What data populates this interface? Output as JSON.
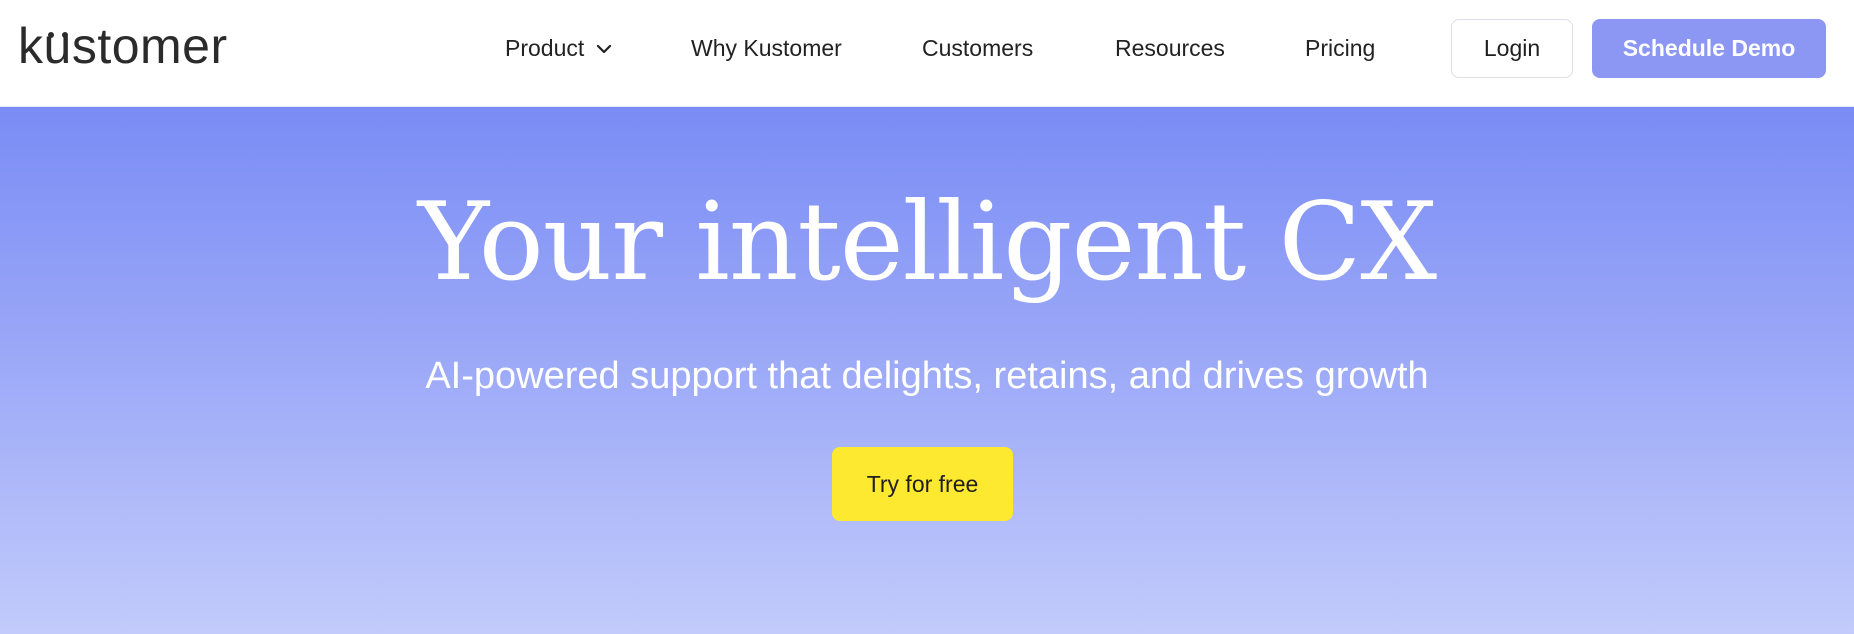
{
  "brand": {
    "logo_text_prefix": "k",
    "logo_text_u": "u",
    "logo_text_suffix": "stomer"
  },
  "nav": {
    "items": [
      {
        "label": "Product",
        "has_dropdown": true
      },
      {
        "label": "Why Kustomer"
      },
      {
        "label": "Customers"
      },
      {
        "label": "Resources"
      },
      {
        "label": "Pricing"
      }
    ],
    "login_label": "Login",
    "demo_label": "Schedule Demo"
  },
  "hero": {
    "title": "Your intelligent CX",
    "subtitle": "AI-powered support that delights, retains, and drives growth",
    "cta_label": "Try for free"
  },
  "colors": {
    "demo_button": "#8b97f3",
    "cta_button": "#fde92f",
    "hero_top": "#7a8cf5",
    "hero_bottom": "#c2cbfb",
    "text_dark": "#222222"
  }
}
